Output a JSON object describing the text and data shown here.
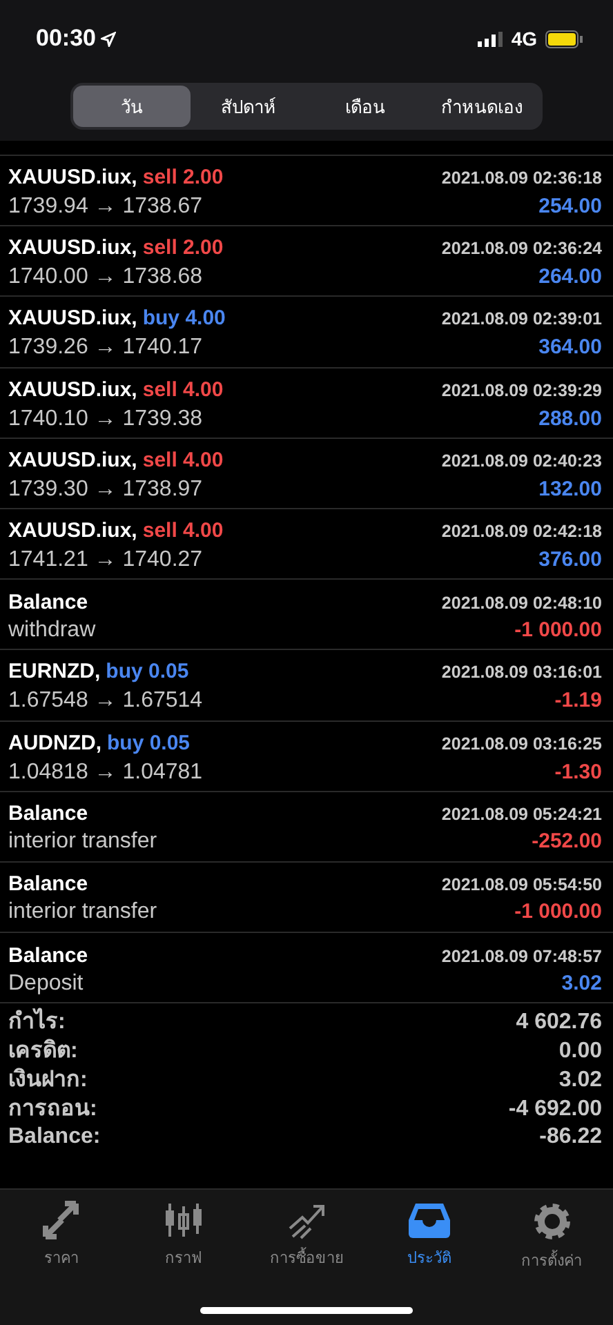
{
  "status_bar": {
    "time": "00:30",
    "network": "4G"
  },
  "period_tabs": [
    {
      "label": "วัน",
      "selected": true
    },
    {
      "label": "สัปดาห์",
      "selected": false
    },
    {
      "label": "เดือน",
      "selected": false
    },
    {
      "label": "กำหนดเอง",
      "selected": false
    }
  ],
  "history": [
    {
      "kind": "trade",
      "symbol": "XAUUSD.iux,",
      "action": {
        "text": "sell 2.00",
        "color": "#f04848"
      },
      "prices": "1739.94 → 1738.67",
      "time": "2021.08.09 02:36:18",
      "result": {
        "text": "254.00",
        "color": "#4a86f0"
      }
    },
    {
      "kind": "trade",
      "symbol": "XAUUSD.iux,",
      "action": {
        "text": "sell 2.00",
        "color": "#f04848"
      },
      "prices": "1740.00 → 1738.68",
      "time": "2021.08.09 02:36:24",
      "result": {
        "text": "264.00",
        "color": "#4a86f0"
      }
    },
    {
      "kind": "trade",
      "symbol": "XAUUSD.iux,",
      "action": {
        "text": "buy 4.00",
        "color": "#4a86f0"
      },
      "prices": "1739.26 → 1740.17",
      "time": "2021.08.09 02:39:01",
      "result": {
        "text": "364.00",
        "color": "#4a86f0"
      }
    },
    {
      "kind": "trade",
      "symbol": "XAUUSD.iux,",
      "action": {
        "text": "sell 4.00",
        "color": "#f04848"
      },
      "prices": "1740.10 → 1739.38",
      "time": "2021.08.09 02:39:29",
      "result": {
        "text": "288.00",
        "color": "#4a86f0"
      }
    },
    {
      "kind": "trade",
      "symbol": "XAUUSD.iux,",
      "action": {
        "text": "sell 4.00",
        "color": "#f04848"
      },
      "prices": "1739.30 → 1738.97",
      "time": "2021.08.09 02:40:23",
      "result": {
        "text": "132.00",
        "color": "#4a86f0"
      }
    },
    {
      "kind": "trade",
      "symbol": "XAUUSD.iux,",
      "action": {
        "text": "sell 4.00",
        "color": "#f04848"
      },
      "prices": "1741.21 → 1740.27",
      "time": "2021.08.09 02:42:18",
      "result": {
        "text": "376.00",
        "color": "#4a86f0"
      }
    },
    {
      "kind": "balance",
      "title": "Balance",
      "comment": "withdraw",
      "time": "2021.08.09 02:48:10",
      "result": {
        "text": "-1 000.00",
        "color": "#f04848"
      }
    },
    {
      "kind": "trade",
      "symbol": "EURNZD,",
      "action": {
        "text": "buy 0.05",
        "color": "#4a86f0"
      },
      "prices": "1.67548 → 1.67514",
      "time": "2021.08.09 03:16:01",
      "result": {
        "text": "-1.19",
        "color": "#f04848"
      }
    },
    {
      "kind": "trade",
      "symbol": "AUDNZD,",
      "action": {
        "text": "buy 0.05",
        "color": "#4a86f0"
      },
      "prices": "1.04818 → 1.04781",
      "time": "2021.08.09 03:16:25",
      "result": {
        "text": "-1.30",
        "color": "#f04848"
      }
    },
    {
      "kind": "balance",
      "title": "Balance",
      "comment": "interior transfer",
      "time": "2021.08.09 05:24:21",
      "result": {
        "text": "-252.00",
        "color": "#f04848"
      }
    },
    {
      "kind": "balance",
      "title": "Balance",
      "comment": "interior transfer",
      "time": "2021.08.09 05:54:50",
      "result": {
        "text": "-1 000.00",
        "color": "#f04848"
      }
    },
    {
      "kind": "balance",
      "title": "Balance",
      "comment": "Deposit",
      "time": "2021.08.09 07:48:57",
      "result": {
        "text": "3.02",
        "color": "#4a86f0"
      }
    }
  ],
  "summary": [
    {
      "label": "กำไร:",
      "value": "4 602.76"
    },
    {
      "label": "เครดิต:",
      "value": "0.00"
    },
    {
      "label": "เงินฝาก:",
      "value": "3.02"
    },
    {
      "label": "การถอน:",
      "value": "-4 692.00"
    },
    {
      "label": "Balance:",
      "value": "-86.22"
    }
  ],
  "tab_bar": [
    {
      "label": "ราคา",
      "selected": false
    },
    {
      "label": "กราฟ",
      "selected": false
    },
    {
      "label": "การซื้อขาย",
      "selected": false
    },
    {
      "label": "ประวัติ",
      "selected": true
    },
    {
      "label": "การตั้งค่า",
      "selected": false
    }
  ]
}
